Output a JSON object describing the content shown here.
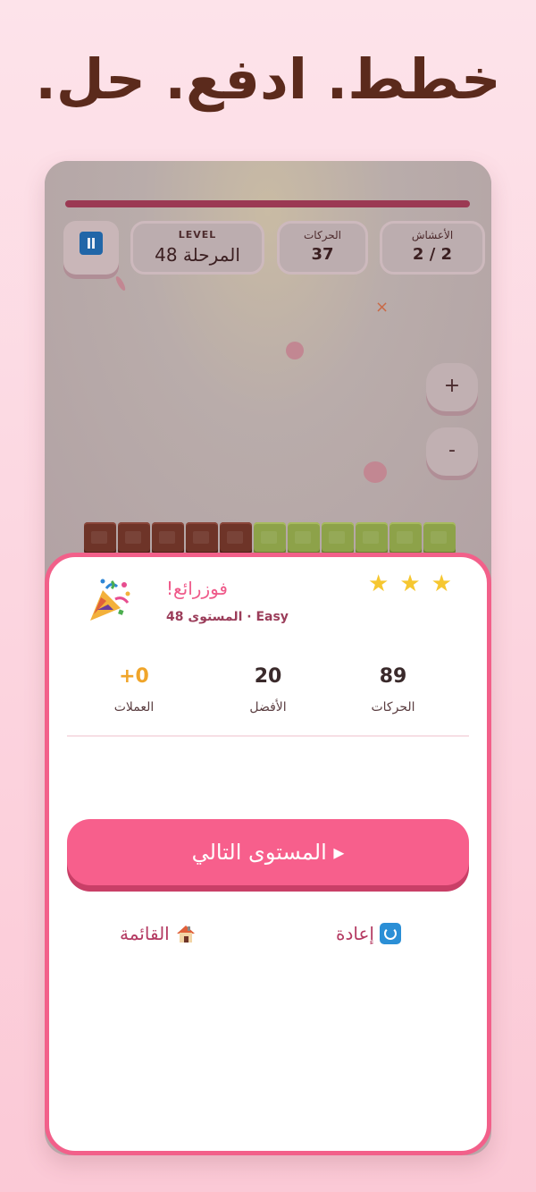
{
  "headline": "خطط. ادفع. حل.",
  "hud": {
    "level_caption": "LEVEL",
    "level_value": "المرحلة 48",
    "moves_caption": "الحركات",
    "moves_value": "37",
    "grass_caption": "الأعشاش",
    "grass_value": "2 / 2",
    "zoom_in": "+",
    "zoom_out": "-",
    "close_mark": "×"
  },
  "board": {
    "blocks": [
      "chocolate",
      "chocolate",
      "chocolate",
      "chocolate",
      "chocolate",
      "grass",
      "grass",
      "grass",
      "grass",
      "grass",
      "grass"
    ]
  },
  "result": {
    "stars_earned": 3,
    "title": "فوزرائع!",
    "subtitle": "Easy · المستوى 48",
    "stats": {
      "moves_value": "89",
      "moves_label": "الحركات",
      "best_value": "20",
      "best_label": "الأفضل",
      "coins_value": "+0",
      "coins_label": "العملات"
    },
    "next_button": "▸ المستوى التالي",
    "retry_label": "إعادة",
    "menu_label": "القائمة"
  },
  "colors": {
    "accent": "#f75f8c",
    "headline": "#5b2a1c",
    "star": "#f6c730",
    "coins": "#f0a52a"
  }
}
